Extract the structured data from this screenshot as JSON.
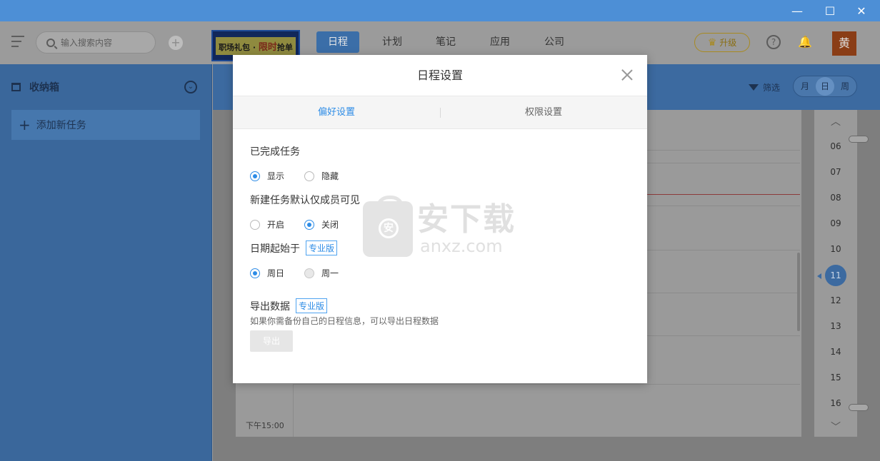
{
  "window": {
    "minimize": "—",
    "maximize": "☐",
    "close": "✕"
  },
  "header": {
    "search_placeholder": "输入搜索内容",
    "add_symbol": "+",
    "banner": {
      "text1": "职场礼包 · ",
      "highlight": "限时",
      "text2": "抢单"
    },
    "tabs": [
      "日程",
      "计划",
      "笔记",
      "应用",
      "公司"
    ],
    "active_tab": "日程",
    "upgrade_label": "升级",
    "help_symbol": "?",
    "avatar_text": "黄"
  },
  "sidebar": {
    "inbox_label": "收纳箱",
    "add_task_label": "添加新任务"
  },
  "main": {
    "filter_label": "筛选",
    "view_options": [
      "月",
      "日",
      "周"
    ],
    "active_view": "日",
    "time_label": "下午15:00",
    "hours": [
      "06",
      "07",
      "08",
      "09",
      "10",
      "11",
      "12",
      "13",
      "14",
      "15",
      "16"
    ],
    "current_hour": "11"
  },
  "modal": {
    "title": "日程设置",
    "tabs": [
      "偏好设置",
      "权限设置"
    ],
    "active_tab": "偏好设置",
    "completed_tasks": {
      "label": "已完成任务",
      "options": [
        "显示",
        "隐藏"
      ],
      "selected": "显示"
    },
    "default_visibility": {
      "label": "新建任务默认仅成员可见",
      "options": [
        "开启",
        "关闭"
      ],
      "selected": "关闭"
    },
    "week_start": {
      "label": "日期起始于",
      "badge": "专业版",
      "options": [
        "周日",
        "周一"
      ],
      "selected": "周日"
    },
    "export": {
      "label": "导出数据",
      "badge": "专业版",
      "hint": "如果你需备份自己的日程信息，可以导出日程数据",
      "button": "导出"
    }
  },
  "watermark": {
    "cn": "安下载",
    "en": "anxz.com",
    "bag_char": "安"
  },
  "colors": {
    "accent": "#2d8ce6",
    "titlebar": "#4d8fd6"
  }
}
